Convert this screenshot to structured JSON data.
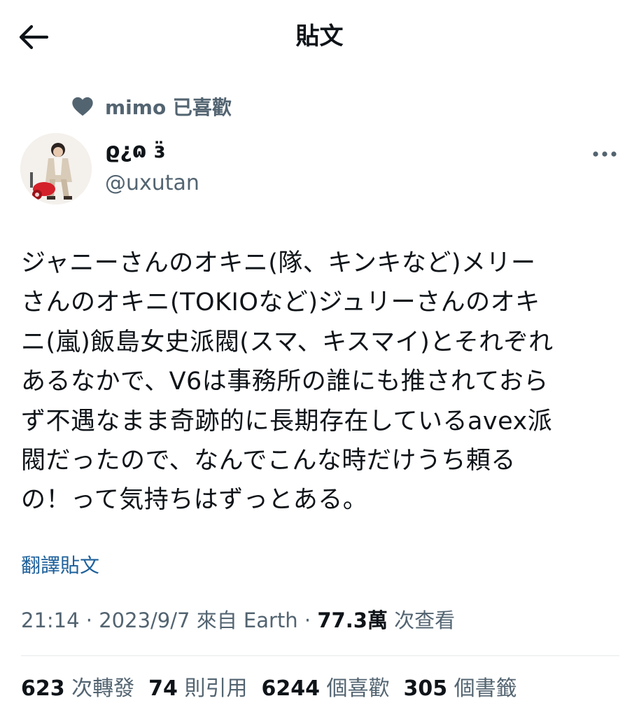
{
  "header": {
    "title": "貼文",
    "back_icon": "arrow-left-icon"
  },
  "social_context": {
    "icon": "heart-icon",
    "text": "mimo 已喜歡"
  },
  "author": {
    "display_name": "ϱ¿ɷ ɜ̈",
    "handle": "@uxutan"
  },
  "tweet": {
    "text": "ジャニーさんのオキニ(隊、キンキなど)メリー\nさんのオキニ(TOKIOなど)ジュリーさんのオキ\nニ(嵐)飯島女史派閥(スマ、キスマイ)とそれぞれ\nあるなかで、V6は事務所の誰にも推されておら\nず不遇なまま奇跡的に長期存在しているavex派\n閥だったので、なんでこんな時だけうち頼る\nの！って気持ちはずっとある。",
    "translate_label": "翻譯貼文"
  },
  "meta": {
    "time": "21:14",
    "sep1": " · ",
    "date": "2023/9/7",
    "source": " 來自 Earth",
    "sep2": " · ",
    "views_count": "77.3萬",
    "views_label": " 次查看"
  },
  "stats": [
    {
      "count": "623",
      "label": " 次轉發"
    },
    {
      "count": "74",
      "label": " 則引用"
    },
    {
      "count": "6244",
      "label": " 個喜歡"
    },
    {
      "count": "305",
      "label": " 個書籤"
    }
  ],
  "colors": {
    "text": "#0f1419",
    "secondary": "#536471",
    "link": "#1d609b",
    "divider": "#e6e9ec"
  }
}
